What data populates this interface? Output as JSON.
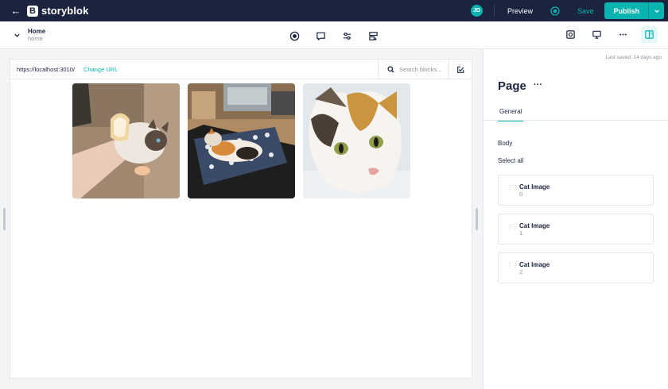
{
  "app": {
    "name": "storyblok",
    "logo_letter": "B"
  },
  "topbar": {
    "back_glyph": "←",
    "avatar_initials": "JD",
    "preview_label": "Preview",
    "save_label": "Save",
    "publish_label": "Publish",
    "publish_caret": "⌄"
  },
  "story": {
    "title": "Home",
    "slug": "home"
  },
  "preview": {
    "url": "https://localhost:3010/",
    "change_url_label": "Change URL",
    "search_placeholder": "Search blocks..."
  },
  "panel": {
    "last_saved": "Last saved: 14 days ago",
    "title": "Page",
    "more_glyph": "···",
    "tab_general": "General",
    "field_label": "Body",
    "select_all": "Select all",
    "blocks": [
      {
        "name": "Cat Image",
        "index": "0"
      },
      {
        "name": "Cat Image",
        "index": "1"
      },
      {
        "name": "Cat Image",
        "index": "2"
      }
    ]
  },
  "colors": {
    "brand_dark": "#1b243f",
    "accent": "#09b3af"
  }
}
